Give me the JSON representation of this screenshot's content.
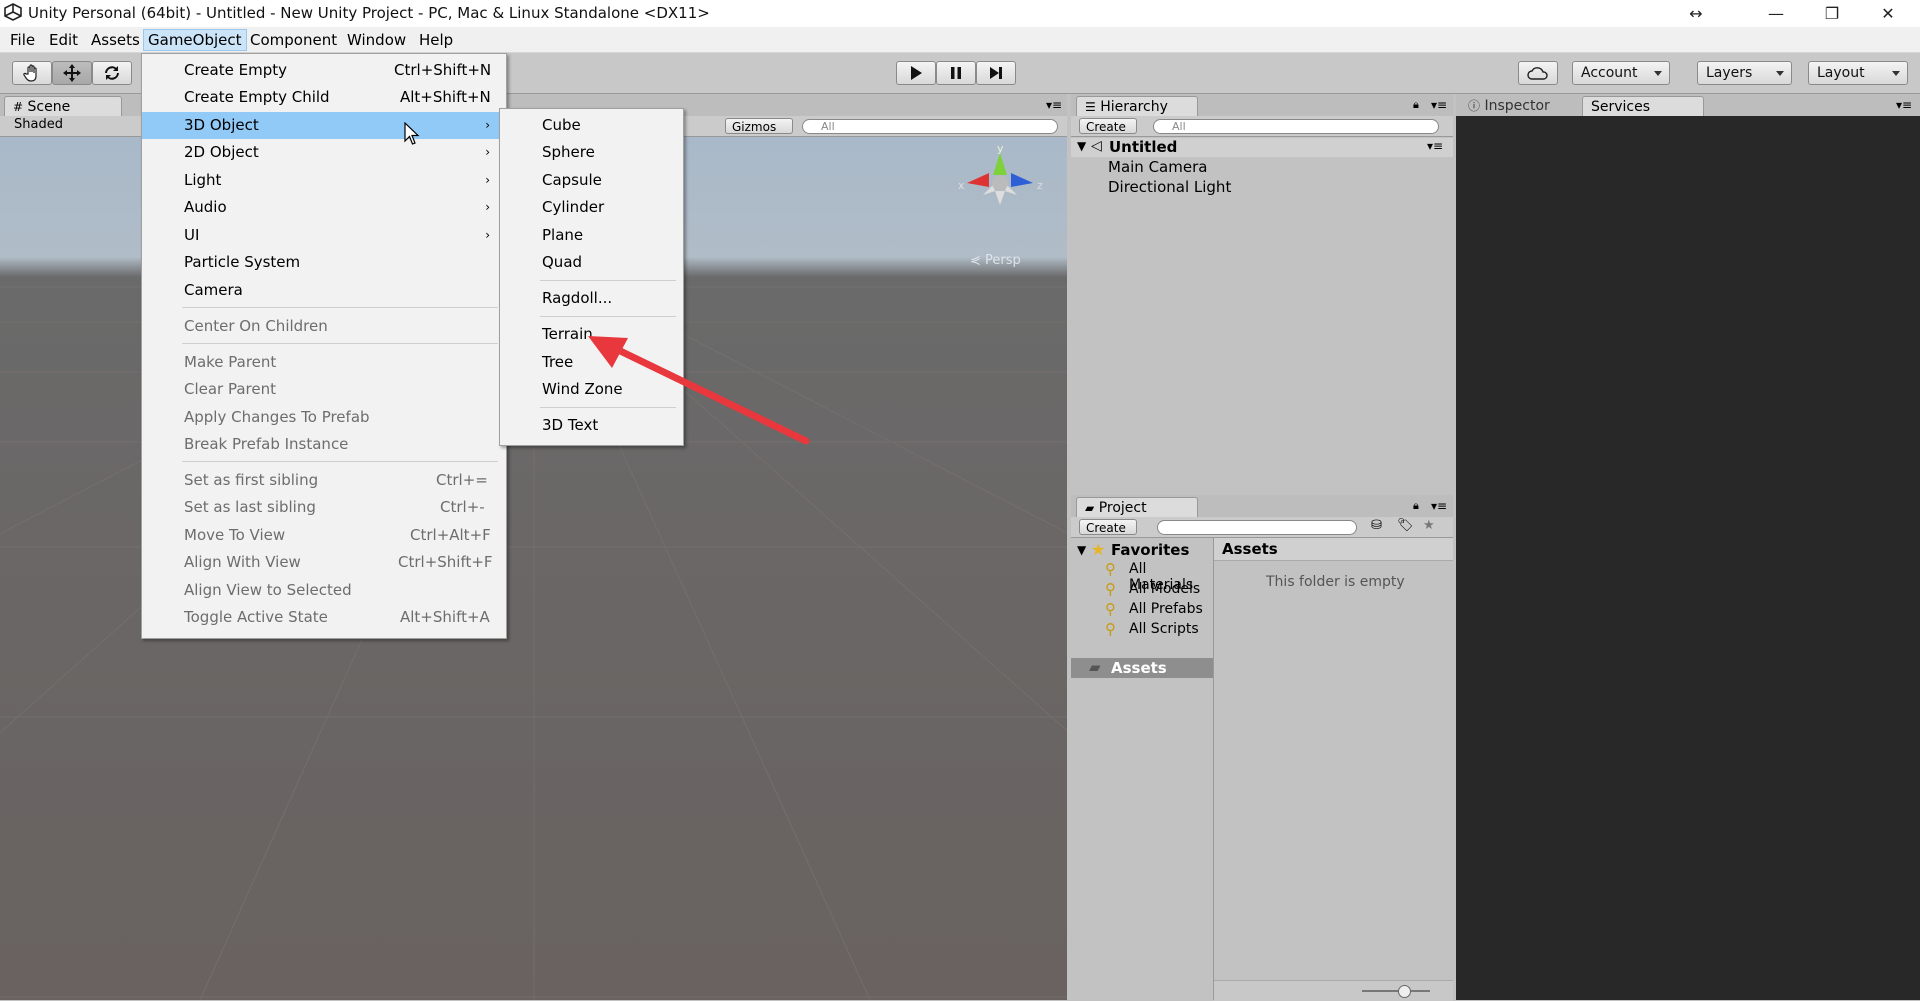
{
  "window": {
    "title": "Unity Personal (64bit) - Untitled - New Unity Project - PC, Mac & Linux Standalone <DX11>",
    "controls": {
      "resize": "↔",
      "minimize": "—",
      "maximize": "❐",
      "close": "✕"
    }
  },
  "menubar": [
    "File",
    "Edit",
    "Assets",
    "GameObject",
    "Component",
    "Window",
    "Help"
  ],
  "toolbar": {
    "account": "Account",
    "layers": "Layers",
    "layout": "Layout"
  },
  "scene": {
    "tab": "Scene",
    "shaded": "Shaded",
    "gizmos": "Gizmos",
    "search_placeholder": "All",
    "persp_label": "Persp",
    "axis_y": "y",
    "axis_x": "x",
    "axis_z": "z"
  },
  "hierarchy": {
    "tab": "Hierarchy",
    "create": "Create",
    "search_placeholder": "All",
    "scene_name": "Untitled",
    "items": [
      "Main Camera",
      "Directional Light"
    ]
  },
  "project": {
    "tab": "Project",
    "create": "Create",
    "favorites": "Favorites",
    "favorite_items": [
      "All Materials",
      "All Models",
      "All Prefabs",
      "All Scripts"
    ],
    "assets_folder": "Assets",
    "assets_header": "Assets",
    "empty_msg": "This folder is empty"
  },
  "inspector": {
    "tab": "Inspector",
    "services_tab": "Services"
  },
  "gameobject_menu": {
    "items": [
      {
        "label": "Create Empty",
        "shortcut": "Ctrl+Shift+N"
      },
      {
        "label": "Create Empty Child",
        "shortcut": "Alt+Shift+N"
      },
      {
        "label": "3D Object",
        "submenu": true
      },
      {
        "label": "2D Object",
        "submenu": true
      },
      {
        "label": "Light",
        "submenu": true
      },
      {
        "label": "Audio",
        "submenu": true
      },
      {
        "label": "UI",
        "submenu": true
      },
      {
        "label": "Particle System"
      },
      {
        "label": "Camera"
      },
      {
        "label": "Center On Children"
      },
      {
        "label": "Make Parent"
      },
      {
        "label": "Clear Parent"
      },
      {
        "label": "Apply Changes To Prefab"
      },
      {
        "label": "Break Prefab Instance"
      },
      {
        "label": "Set as first sibling",
        "shortcut": "Ctrl+="
      },
      {
        "label": "Set as last sibling",
        "shortcut": "Ctrl+-"
      },
      {
        "label": "Move To View",
        "shortcut": "Ctrl+Alt+F"
      },
      {
        "label": "Align With View",
        "shortcut": "Ctrl+Shift+F"
      },
      {
        "label": "Align View to Selected"
      },
      {
        "label": "Toggle Active State",
        "shortcut": "Alt+Shift+A"
      }
    ],
    "submenu_arrow": "›"
  },
  "submenu_3d": {
    "items": [
      "Cube",
      "Sphere",
      "Capsule",
      "Cylinder",
      "Plane",
      "Quad",
      "Ragdoll...",
      "Terrain",
      "Tree",
      "Wind Zone",
      "3D Text"
    ]
  },
  "colors": {
    "menu_highlight": "#91c9f7",
    "annotation_arrow": "#e8383d",
    "inspector_bg": "#282828"
  }
}
